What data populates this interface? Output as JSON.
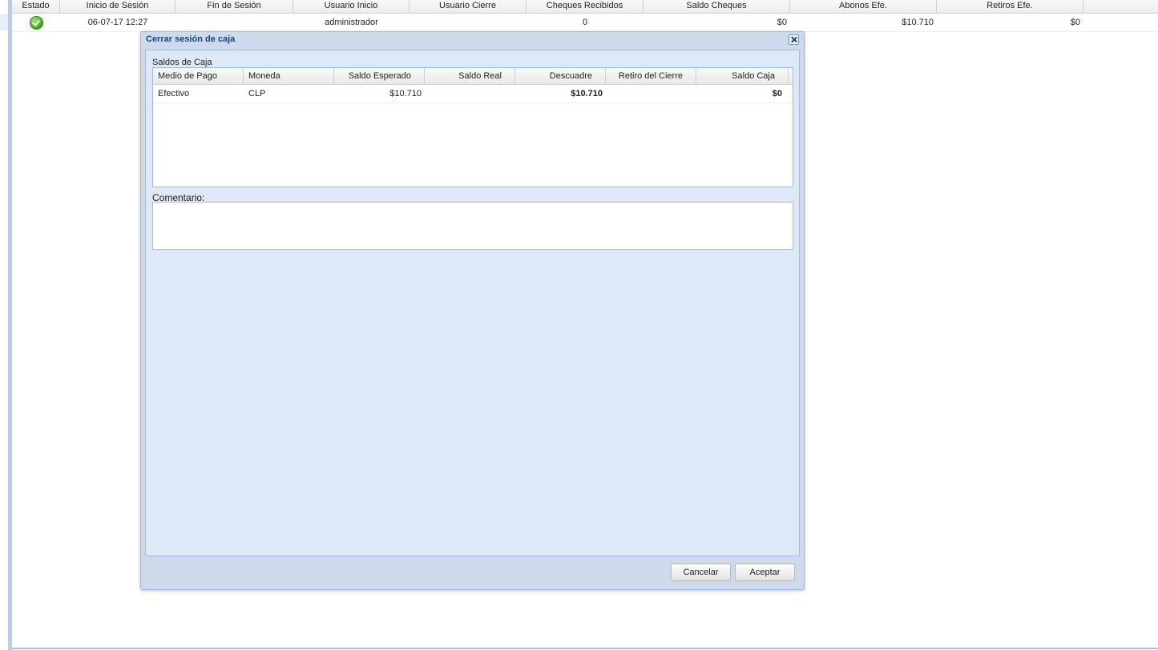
{
  "background_grid": {
    "columns": [
      "Estado",
      "Inicio de Sesión",
      "Fin de Sesión",
      "Usuario Inicio",
      "Usuario Cierre",
      "Cheques Recibidos",
      "Saldo Cheques",
      "Abonos Efe.",
      "Retiros Efe."
    ],
    "row": {
      "status_icon": "check-circle-icon",
      "inicio": "06-07-17 12:27",
      "fin": "",
      "usuario_inicio": "administrador",
      "usuario_cierre": "",
      "cheques_recibidos": "0",
      "saldo_cheques": "$0",
      "abonos_efe": "$10.710",
      "retiros_efe": "$0"
    }
  },
  "dialog": {
    "title": "Cerrar sesión de caja",
    "section_label": "Saldos de Caja",
    "grid": {
      "columns": [
        "Medio de Pago",
        "Moneda",
        "Saldo Esperado",
        "Saldo Real",
        "Descuadre",
        "Retiro del Cierre",
        "Saldo Caja"
      ],
      "rows": [
        {
          "medio_de_pago": "Efectivo",
          "moneda": "CLP",
          "saldo_esperado": "$10.710",
          "saldo_real": "",
          "descuadre": "$10.710",
          "retiro_del_cierre": "",
          "saldo_caja": "$0"
        }
      ]
    },
    "comment_label": "Comentario:",
    "comment_value": "",
    "buttons": {
      "cancel": "Cancelar",
      "accept": "Aceptar"
    }
  },
  "colors": {
    "descuadre": "#e0201c",
    "saldo_caja": "#1a8a1a",
    "title": "#15428b"
  }
}
